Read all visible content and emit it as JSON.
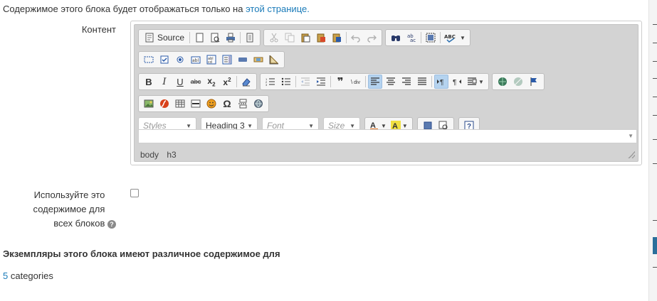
{
  "notice": {
    "text": "Содержимое этого блока будет отображаться только на",
    "link": "этой странице."
  },
  "content_label": "Контент",
  "toolbar": {
    "source_label": "Source",
    "styles_placeholder": "Styles",
    "format_value": "Heading 3",
    "font_placeholder": "Font",
    "size_placeholder": "Size"
  },
  "path": [
    "body",
    "h3"
  ],
  "use_for_all_label": "Используйте это содержимое для всех блоков",
  "help_glyph": "?",
  "instances_text": "Экземпляры этого блока имеют различное содержимое для",
  "categories": {
    "count": "5",
    "label": "categories"
  },
  "colors": {
    "link": "#1a7bb9",
    "editor_bg": "#d3d3d3",
    "active_button": "#b5d3ef"
  }
}
